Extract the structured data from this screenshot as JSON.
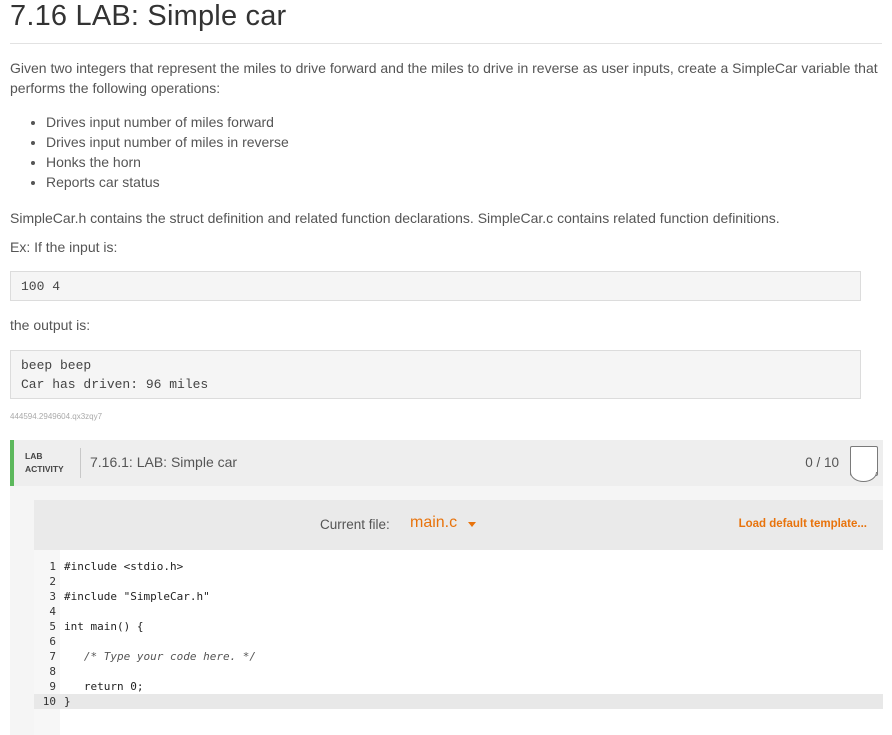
{
  "title": "7.16 LAB: Simple car",
  "intro": "Given two integers that represent the miles to drive forward and the miles to drive in reverse as user inputs, create a SimpleCar variable that performs the following operations:",
  "bullets": [
    "Drives input number of miles forward",
    "Drives input number of miles in reverse",
    "Honks the horn",
    "Reports car status"
  ],
  "struct_note": "SimpleCar.h contains the struct definition and related function declarations. SimpleCar.c contains related function definitions.",
  "example_label": "Ex: If the input is:",
  "example_input": "100 4",
  "output_label": "the output is:",
  "example_output_lines": [
    "beep beep",
    "Car has driven: 96 miles"
  ],
  "id_tag": "444594.2949604.qx3zqy7",
  "lab": {
    "tag_line1": "LAB",
    "tag_line2": "ACTIVITY",
    "title": "7.16.1: LAB: Simple car",
    "score": "0 / 10"
  },
  "editor": {
    "current_file_label": "Current file:",
    "current_file": "main.c",
    "load_template": "Load default template...",
    "lines": [
      {
        "n": "1",
        "code": "#include <stdio.h>"
      },
      {
        "n": "2",
        "code": ""
      },
      {
        "n": "3",
        "code": "#include \"SimpleCar.h\""
      },
      {
        "n": "4",
        "code": ""
      },
      {
        "n": "5",
        "code": "int main() {"
      },
      {
        "n": "6",
        "code": ""
      },
      {
        "n": "7",
        "code": "   /* Type your code here. */"
      },
      {
        "n": "8",
        "code": ""
      },
      {
        "n": "9",
        "code": "   return 0;"
      },
      {
        "n": "10",
        "code": "}"
      }
    ]
  }
}
